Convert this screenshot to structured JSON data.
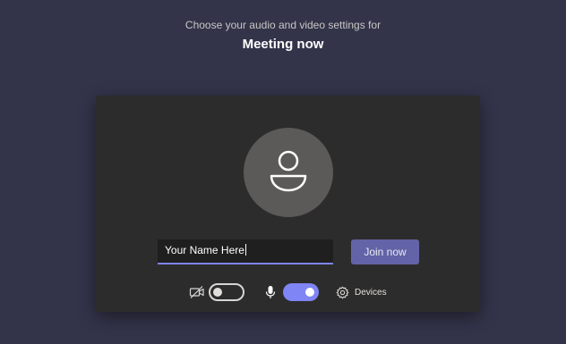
{
  "header": {
    "subtitle": "Choose your audio and video settings for",
    "title": "Meeting now"
  },
  "name_input": {
    "value": "Your Name Here",
    "placeholder": ""
  },
  "join_button": {
    "label": "Join now"
  },
  "controls": {
    "camera": {
      "enabled": false,
      "icon": "camera-off-icon"
    },
    "microphone": {
      "enabled": true,
      "icon": "microphone-icon"
    },
    "devices_label": "Devices",
    "devices_icon": "gear-icon"
  },
  "avatar": {
    "icon": "person-icon"
  },
  "colors": {
    "background": "#33344a",
    "panel": "#2d2c2c",
    "accent": "#6264a7",
    "toggle_on": "#7f85f5"
  }
}
